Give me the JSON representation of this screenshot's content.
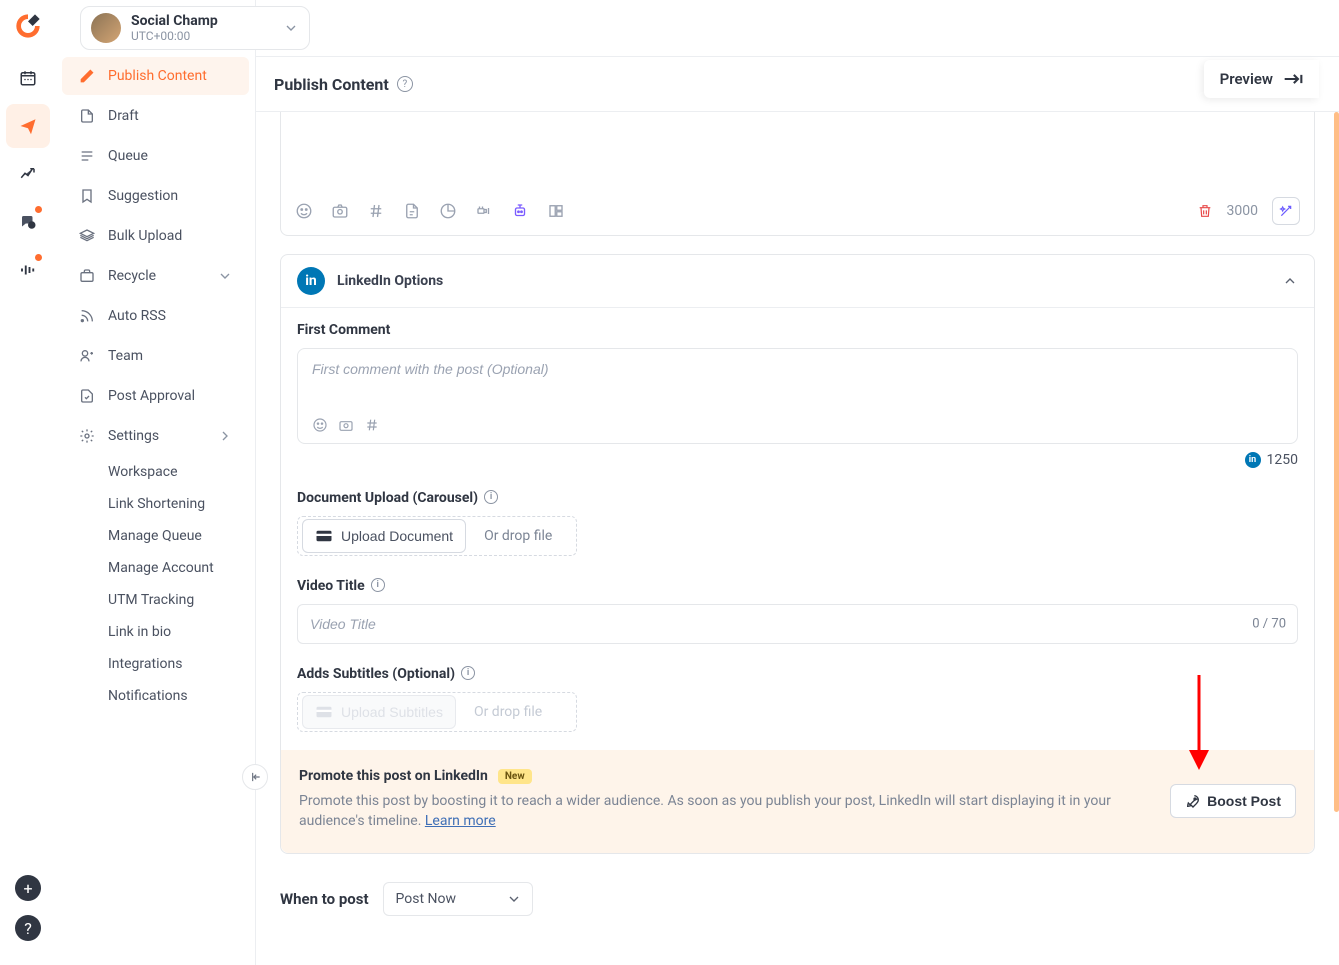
{
  "workspace": {
    "name": "Social Champ",
    "timezone": "UTC+00:00"
  },
  "header": {
    "title": "Publish Content",
    "preview_label": "Preview"
  },
  "sidebar": {
    "items": [
      {
        "label": "Publish Content"
      },
      {
        "label": "Draft"
      },
      {
        "label": "Queue"
      },
      {
        "label": "Suggestion"
      },
      {
        "label": "Bulk Upload"
      },
      {
        "label": "Recycle"
      },
      {
        "label": "Auto RSS"
      },
      {
        "label": "Team"
      },
      {
        "label": "Post Approval"
      },
      {
        "label": "Settings"
      }
    ],
    "settings_sub": [
      {
        "label": "Workspace"
      },
      {
        "label": "Link Shortening"
      },
      {
        "label": "Manage Queue"
      },
      {
        "label": "Manage Account"
      },
      {
        "label": "UTM Tracking"
      },
      {
        "label": "Link in bio"
      },
      {
        "label": "Integrations"
      },
      {
        "label": "Notifications"
      }
    ]
  },
  "composer": {
    "char_count": "3000"
  },
  "linkedin": {
    "section_title": "LinkedIn Options",
    "first_comment": {
      "label": "First Comment",
      "placeholder": "First comment with the post (Optional)",
      "char_count": "1250"
    },
    "doc_upload": {
      "label": "Document Upload (Carousel)",
      "button": "Upload Document",
      "drop": "Or drop file"
    },
    "video_title": {
      "label": "Video Title",
      "placeholder": "Video Title",
      "count": "0 / 70"
    },
    "subtitles": {
      "label": "Adds Subtitles (Optional)",
      "button": "Upload Subtitles",
      "drop": "Or drop file"
    },
    "promote": {
      "title": "Promote this post on LinkedIn",
      "badge": "New",
      "desc": "Promote this post by boosting it to reach a wider audience. As soon as you publish your post, LinkedIn will start displaying it in your audience's timeline. ",
      "learn": "Learn more",
      "boost": "Boost Post"
    }
  },
  "when": {
    "label": "When to post",
    "value": "Post Now"
  }
}
